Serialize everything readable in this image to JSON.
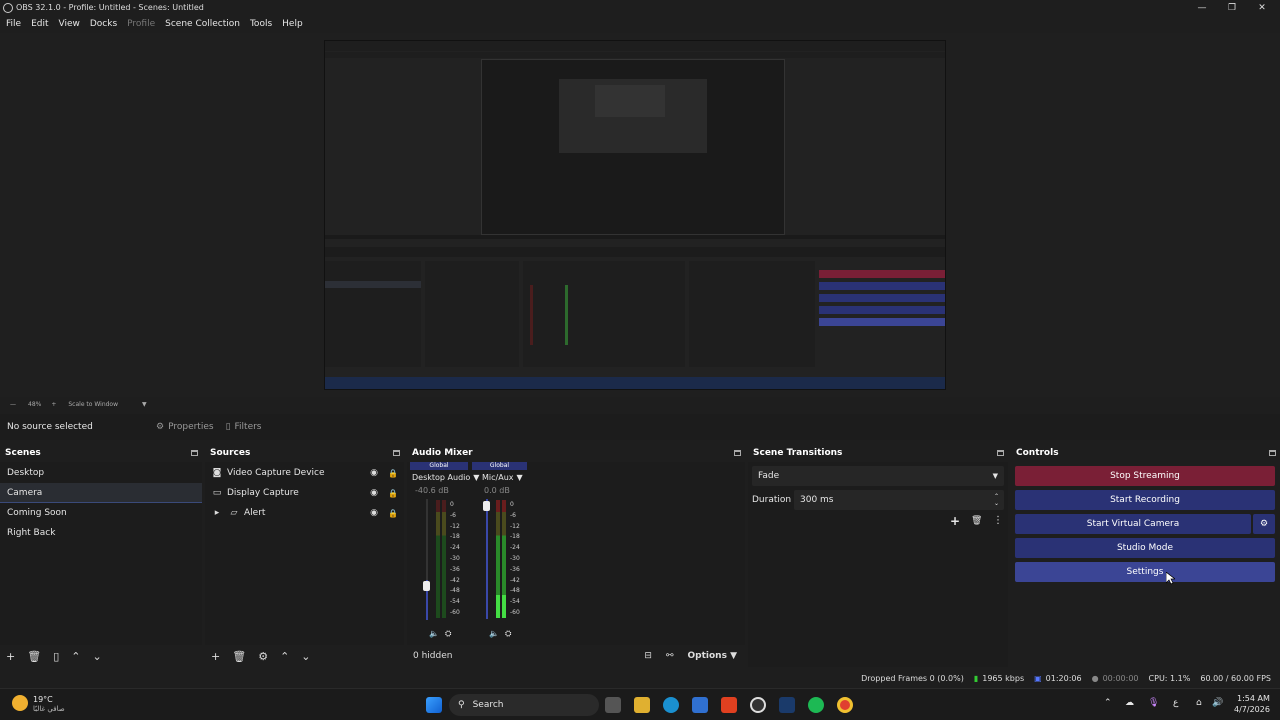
{
  "window": {
    "title": "OBS 32.1.0 - Profile: Untitled - Scenes: Untitled",
    "controls": [
      "—",
      "❐",
      "✕"
    ]
  },
  "menu": [
    "File",
    "Edit",
    "View",
    "Docks",
    "Profile",
    "Scene Collection",
    "Tools",
    "Help"
  ],
  "zoom": {
    "value": "48%",
    "scale_label": "Scale to Window"
  },
  "source_toolbar": {
    "no_source": "No source selected",
    "properties": "Properties",
    "filters": "Filters"
  },
  "scenes": {
    "title": "Scenes",
    "items": [
      "Desktop",
      "Camera",
      "Coming Soon",
      "Right Back"
    ],
    "selected": "Camera"
  },
  "sources": {
    "title": "Sources",
    "items": [
      {
        "label": "Video Capture Device",
        "icon": "camera-icon"
      },
      {
        "label": "Display Capture",
        "icon": "monitor-icon"
      },
      {
        "label": "Alert",
        "icon": "folder-icon"
      }
    ]
  },
  "audio_mixer": {
    "title": "Audio Mixer",
    "channels": [
      {
        "badge": "Global",
        "name": "Desktop Audio",
        "db": "-40.6 dB",
        "level": 0.05
      },
      {
        "badge": "Global",
        "name": "Mic/Aux",
        "db": "0.0 dB",
        "level": 1.0
      }
    ],
    "scale": [
      "0",
      "-6",
      "-12",
      "-18",
      "-24",
      "-30",
      "-36",
      "-42",
      "-48",
      "-54",
      "-60"
    ],
    "hidden": "0 hidden",
    "options": "Options"
  },
  "transitions": {
    "title": "Scene Transitions",
    "selected": "Fade",
    "duration_label": "Duration",
    "duration_value": "300 ms"
  },
  "controls": {
    "title": "Controls",
    "stop_streaming": "Stop Streaming",
    "start_recording": "Start Recording",
    "start_virtual_camera": "Start Virtual Camera",
    "studio_mode": "Studio Mode",
    "settings": "Settings",
    "colors": {
      "stop": "#7a1f36",
      "primary": "#2a3275",
      "hover": "#3b4595"
    }
  },
  "status": {
    "dropped": "Dropped Frames 0 (0.0%)",
    "bitrate": "1965 kbps",
    "stream_time": "01:20:06",
    "rec_time": "00:00:00",
    "cpu": "CPU: 1.1%",
    "fps": "60.00 / 60.00 FPS"
  },
  "taskbar": {
    "weather_temp": "19°C",
    "weather_desc": "صافي غالبًا",
    "search": "Search",
    "lang": "ع",
    "time": "1:54 AM",
    "date": "4/7/2026"
  }
}
